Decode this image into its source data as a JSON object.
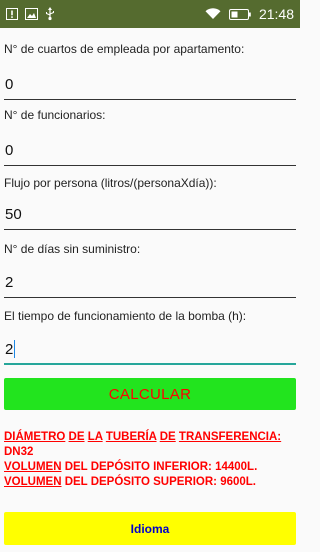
{
  "status_bar": {
    "time": "21:48",
    "icons": [
      "warning-icon",
      "image-icon",
      "usb-icon",
      "wifi-icon",
      "battery-icon"
    ]
  },
  "form": {
    "fields": [
      {
        "label": "N° de cuartos de empleada por apartamento:",
        "value": "0"
      },
      {
        "label": "N° de funcionarios:",
        "value": "0"
      },
      {
        "label": "Flujo por persona (litros/(personaXdía)):",
        "value": "50"
      },
      {
        "label": "N° de días sin suministro:",
        "value": "2"
      },
      {
        "label": "El tiempo de funcionamiento de la bomba (h):",
        "value": "2"
      }
    ]
  },
  "calculate_button": {
    "label": "CALCULAR"
  },
  "results": {
    "line1": {
      "w1": "DIÁMETRO",
      "w2": "DE",
      "w3": "LA",
      "w4": "TUBERÍA",
      "w5": "DE",
      "w6": "TRANSFERENCIA:"
    },
    "line2": "DN32",
    "line3": {
      "w1": "VOLUMEN",
      "rest": "DEL DEPÓSITO INFERIOR: 14400L."
    },
    "line4": {
      "w1": "VOLUMEN",
      "rest": "DEL DEPÓSITO SUPERIOR: 9600L."
    }
  },
  "language_button": {
    "label": "Idioma"
  },
  "colors": {
    "status_bar": "#556b2f",
    "calculate_bg": "#22e41e",
    "calculate_text": "#ff0000",
    "results_text": "#ff0000",
    "language_bg": "#ffff00",
    "language_text": "#0000cc",
    "active_underline": "#26a69a"
  }
}
